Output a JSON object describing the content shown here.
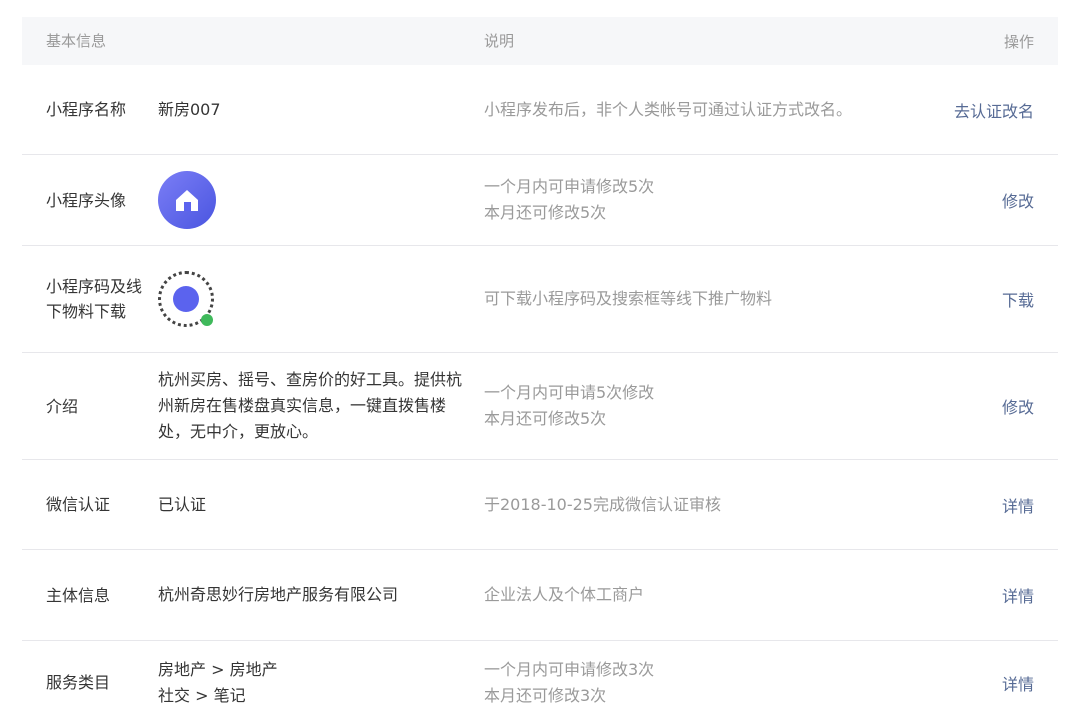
{
  "header": {
    "col1": "基本信息",
    "col3": "说明",
    "col4": "操作"
  },
  "rows": [
    {
      "label": "小程序名称",
      "value": "新房007",
      "desc": "小程序发布后，非个人类帐号可通过认证方式改名。",
      "action": "去认证改名"
    },
    {
      "label": "小程序头像",
      "icon": "house-avatar-icon",
      "desc1": "一个月内可申请修改5次",
      "desc2": "本月还可修改5次",
      "action": "修改"
    },
    {
      "label": "小程序码及线下物料下载",
      "icon": "qr-code-icon",
      "desc": "可下载小程序码及搜索框等线下推广物料",
      "action": "下载"
    },
    {
      "label": "介绍",
      "value": "杭州买房、摇号、查房价的好工具。提供杭州新房在售楼盘真实信息，一键直拨售楼处，无中介，更放心。",
      "desc1": "一个月内可申请5次修改",
      "desc2": "本月还可修改5次",
      "action": "修改"
    },
    {
      "label": "微信认证",
      "value": "已认证",
      "desc": "于2018-10-25完成微信认证审核",
      "action": "详情"
    },
    {
      "label": "主体信息",
      "value": "杭州奇思妙行房地产服务有限公司",
      "desc": "企业法人及个体工商户",
      "action": "详情"
    },
    {
      "label": "服务类目",
      "value1": "房地产 > 房地产",
      "value2": "社交 > 笔记",
      "desc1": "一个月内可申请修改3次",
      "desc2": "本月还可修改3次",
      "action": "详情"
    }
  ]
}
